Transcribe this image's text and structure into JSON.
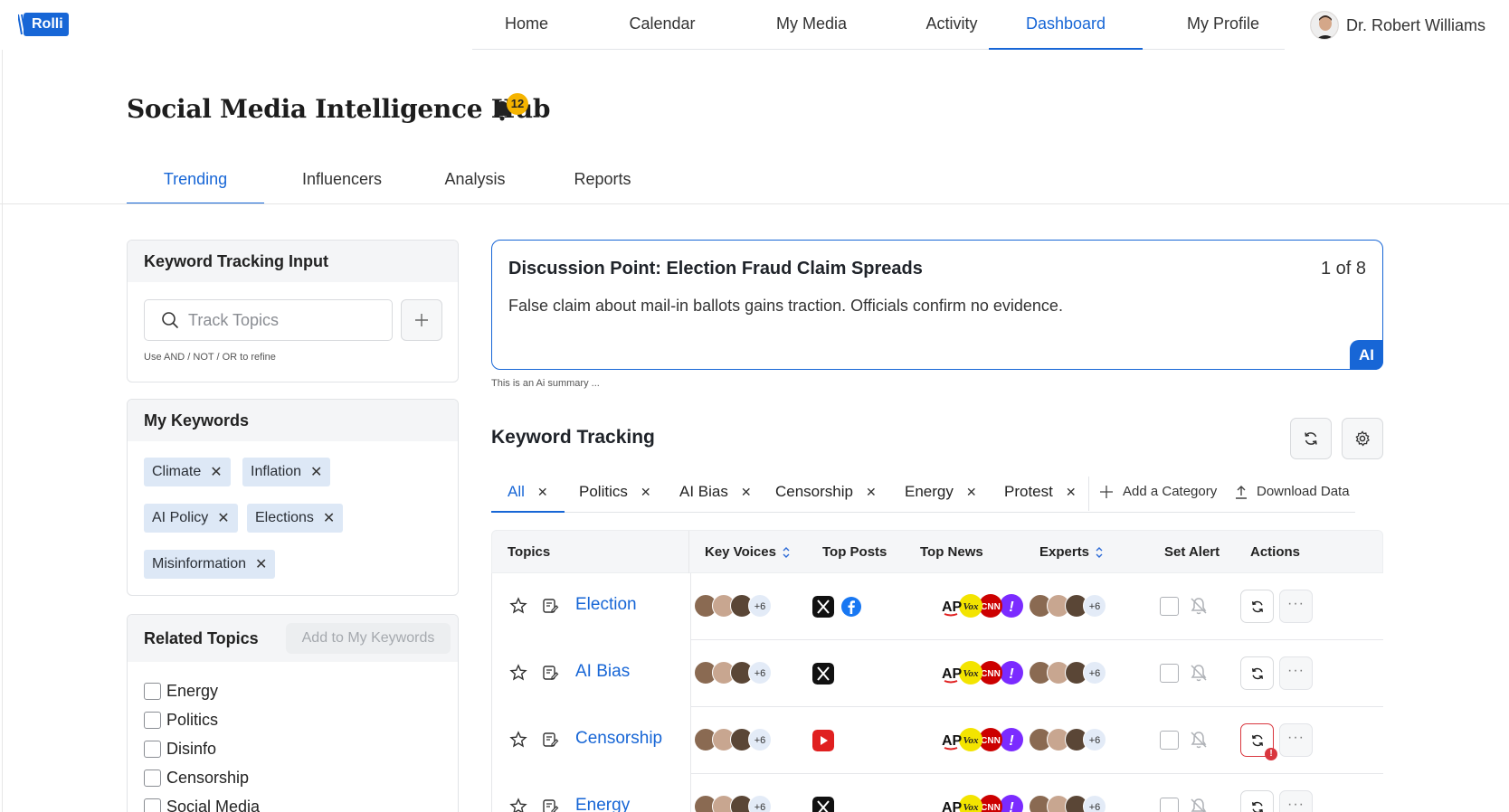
{
  "brand": {
    "logo_text": "Rolli"
  },
  "nav": {
    "items": [
      "Home",
      "Calendar",
      "My Media",
      "Activity",
      "Dashboard",
      "My Profile"
    ],
    "active": "Dashboard",
    "user_name": "Dr. Robert Williams"
  },
  "page": {
    "title": "Social Media Intelligence Hub",
    "notification_count": "12",
    "tabs": [
      "Trending",
      "Influencers",
      "Analysis",
      "Reports"
    ],
    "active_tab": "Trending"
  },
  "keyword_input": {
    "title": "Keyword Tracking Input",
    "placeholder": "Track Topics",
    "hint": "Use AND / NOT / OR to refine"
  },
  "my_keywords": {
    "title": "My Keywords",
    "chips": [
      "Climate",
      "Inflation",
      "AI Policy",
      "Elections",
      "Misinformation"
    ],
    "remove_glyph": "✕"
  },
  "related_topics": {
    "title": "Related Topics",
    "add_button": "Add to My Keywords",
    "items": [
      "Energy",
      "Politics",
      "Disinfo",
      "Censorship",
      "Social Media"
    ]
  },
  "discussion": {
    "title": "Discussion Point: Election Fraud Claim Spreads",
    "counter": "1 of 8",
    "body": "False claim about mail-in ballots gains traction. Officials confirm no evidence.",
    "ai_badge": "AI",
    "ai_note": "This is an Ai summary ..."
  },
  "keyword_tracking": {
    "title": "Keyword Tracking",
    "categories": [
      "All",
      "Politics",
      "AI Bias",
      "Censorship",
      "Energy",
      "Protest"
    ],
    "active_category": "All",
    "add_category": "Add a Category",
    "download": "Download Data"
  },
  "table": {
    "headers": {
      "topics": "Topics",
      "key_voices": "Key Voices",
      "top_posts": "Top Posts",
      "top_news": "Top News",
      "experts": "Experts",
      "set_alert": "Set Alert",
      "actions": "Actions"
    },
    "more_count": "+6",
    "rows": [
      {
        "topic": "Election",
        "posts": [
          "x-icon",
          "facebook-icon"
        ],
        "refresh_warning": false
      },
      {
        "topic": "AI Bias",
        "posts": [
          "x-icon"
        ],
        "refresh_warning": false
      },
      {
        "topic": "Censorship",
        "posts": [
          "youtube-icon"
        ],
        "refresh_warning": true,
        "warning_glyph": "!"
      },
      {
        "topic": "Energy",
        "posts": [
          "x-icon"
        ],
        "refresh_warning": false
      }
    ],
    "news_sources": [
      "AP",
      "Vox",
      "CNN",
      "Yahoo"
    ]
  },
  "colors": {
    "accent": "#1766d6",
    "badge": "#f5b400",
    "chip_bg": "#dde8f6",
    "warning": "#d9363e"
  }
}
